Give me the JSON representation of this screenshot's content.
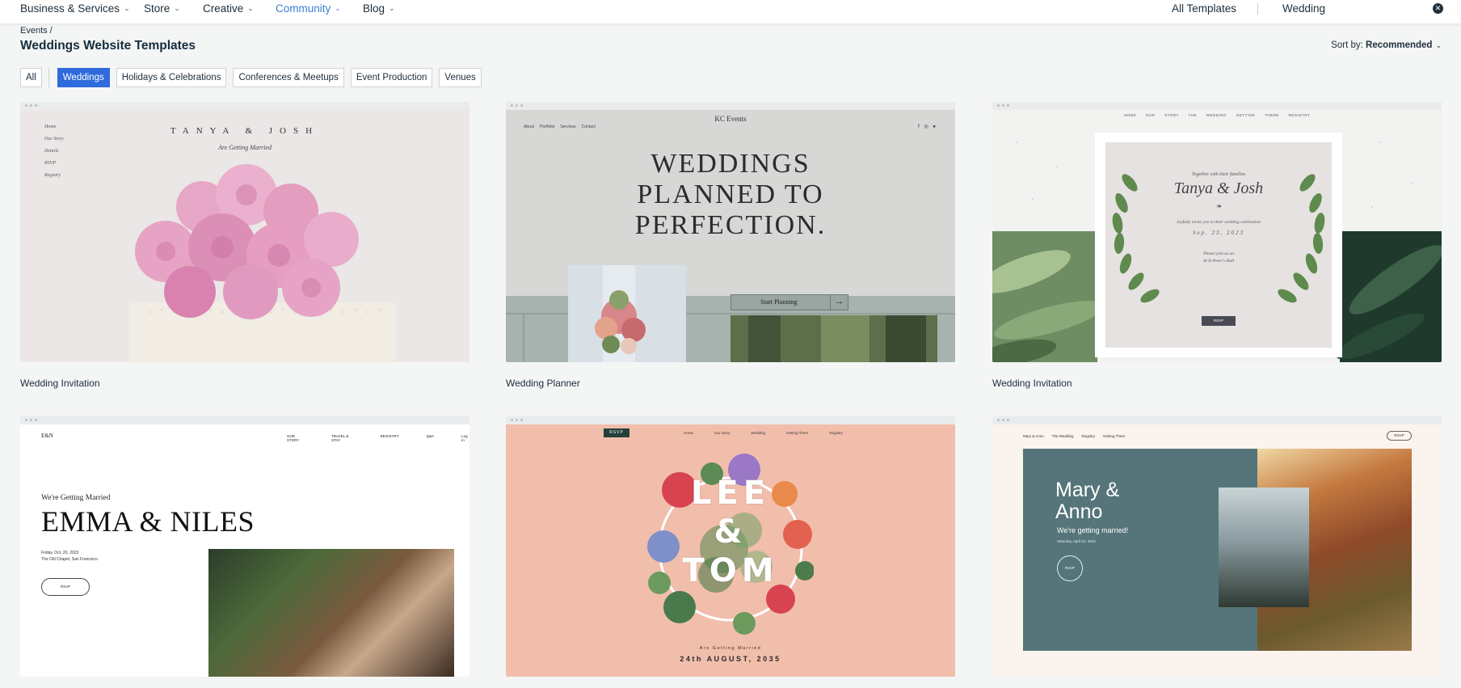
{
  "nav": {
    "items": [
      {
        "label": "Business & Services",
        "active": false
      },
      {
        "label": "Store",
        "active": false
      },
      {
        "label": "Creative",
        "active": false
      },
      {
        "label": "Community",
        "active": true
      },
      {
        "label": "Blog",
        "active": false
      }
    ],
    "all_templates": "All Templates",
    "search_value": "Wedding"
  },
  "breadcrumb": "Events /",
  "page_title": "Weddings Website Templates",
  "sort": {
    "label": "Sort by:",
    "value": "Recommended"
  },
  "filters": [
    {
      "label": "All",
      "active": false
    },
    {
      "label": "Weddings",
      "active": true
    },
    {
      "label": "Holidays & Celebrations",
      "active": false
    },
    {
      "label": "Conferences & Meetups",
      "active": false
    },
    {
      "label": "Event Production",
      "active": false
    },
    {
      "label": "Venues",
      "active": false
    }
  ],
  "templates": [
    {
      "caption": "Wedding Invitation",
      "preview": {
        "names": "TANYA & JOSH",
        "tagline": "Are Getting Married",
        "nav": [
          "Home",
          "Our Story",
          "Details",
          "RSVP",
          "Registry"
        ]
      }
    },
    {
      "caption": "Wedding Planner",
      "preview": {
        "brand": "KC Events",
        "nav": [
          "About",
          "Portfolio",
          "Services",
          "Contact"
        ],
        "headline_lines": [
          "WEDDINGS",
          "PLANNED TO",
          "PERFECTION."
        ],
        "cta": "Start Planning"
      }
    },
    {
      "caption": "Wedding Invitation",
      "preview": {
        "nav": "HOME OUR STORY THE WEDDING GETTING THERE REGISTRY",
        "intro": "Together with their families",
        "names": "Tanya & Josh",
        "invite": "Joyfully invite you to their wedding celebration",
        "date": "Sep. 23, 2023",
        "reply_lines": [
          "Please join us on",
          "At St Peter's Hall"
        ],
        "rsvp": "RSVP"
      }
    },
    {
      "caption": "",
      "preview": {
        "monogram": "E&N",
        "nav": [
          "OUR STORY",
          "TRAVEL & STAY",
          "REGISTRY",
          "Q&A",
          "Log In"
        ],
        "pre": "We're Getting Married",
        "names": "EMMA & NILES",
        "date": "Friday, Oct. 20, 2023",
        "venue": "The Old Chapel, San Francisco",
        "rsvp": "RSVP"
      }
    },
    {
      "caption": "",
      "preview": {
        "rsvp": "RSVP",
        "nav": [
          "Home",
          "Our Story",
          "Wedding",
          "Getting There",
          "Registry"
        ],
        "names": [
          "LEE",
          "&",
          "TOM"
        ],
        "tagline": "Are Getting Married",
        "date": "24th AUGUST, 2035"
      }
    },
    {
      "caption": "",
      "preview": {
        "nav": [
          "Mary & Anno",
          "The Wedding",
          "Registry",
          "Getting There"
        ],
        "rsvp_top": "RSVP",
        "names_lines": [
          "Mary &",
          "Anno"
        ],
        "sub": "We're getting married!",
        "date": "Saturday, April 22, 2023",
        "rsvp": "RSVP"
      }
    }
  ],
  "colors": {
    "accent": "#2f6bdc",
    "nav_active": "#3b7fd0",
    "page_bg": "#f4f5f5"
  }
}
